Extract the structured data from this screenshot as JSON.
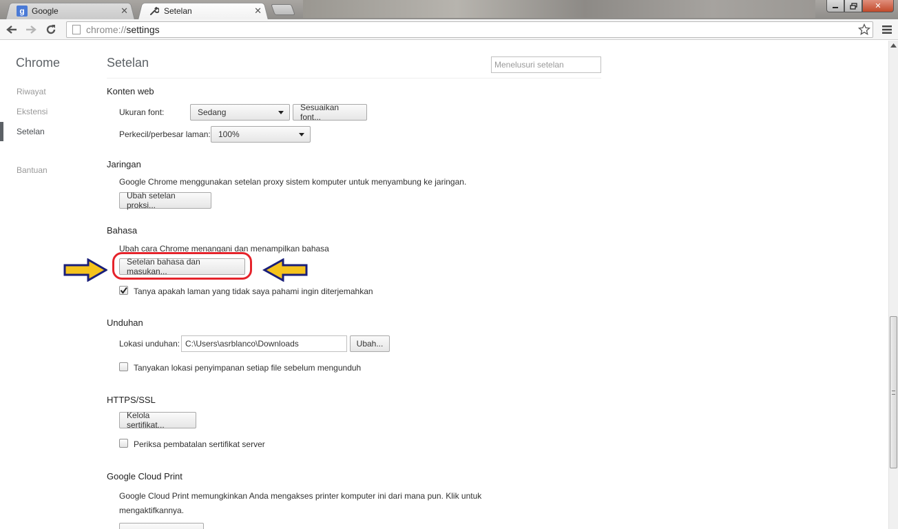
{
  "tabs": [
    {
      "title": "Google",
      "favicon": "google-g-icon",
      "favicon_glyph": "g"
    },
    {
      "title": "Setelan",
      "favicon": "wrench-icon"
    }
  ],
  "window": {
    "close_glyph": "✕"
  },
  "toolbar": {
    "url_scheme": "chrome://",
    "url_host": "settings"
  },
  "sidebar": {
    "brand": "Chrome",
    "items": [
      {
        "label": "Riwayat",
        "selected": false
      },
      {
        "label": "Ekstensi",
        "selected": false
      },
      {
        "label": "Setelan",
        "selected": true
      },
      {
        "label": "Bantuan",
        "selected": false
      }
    ]
  },
  "header": {
    "title": "Setelan",
    "search_placeholder": "Menelusuri setelan"
  },
  "web_content": {
    "title": "Konten web",
    "font_size_label": "Ukuran font:",
    "font_size_value": "Sedang",
    "customize_fonts_button": "Sesuaikan font...",
    "zoom_label": "Perkecil/perbesar laman:",
    "zoom_value": "100%"
  },
  "network": {
    "title": "Jaringan",
    "description": "Google Chrome menggunakan setelan proxy sistem komputer untuk menyambung ke jaringan.",
    "proxy_button": "Ubah setelan proksi..."
  },
  "languages": {
    "title": "Bahasa",
    "description": "Ubah cara Chrome menangani dan menampilkan bahasa",
    "language_button": "Setelan bahasa dan masukan...",
    "translate_checkbox": "Tanya apakah laman yang tidak saya pahami ingin diterjemahkan",
    "translate_checked": true
  },
  "downloads": {
    "title": "Unduhan",
    "location_label": "Lokasi unduhan:",
    "location_value": "C:\\Users\\asrblanco\\Downloads",
    "change_button": "Ubah...",
    "ask_checkbox": "Tanyakan lokasi penyimpanan setiap file sebelum mengunduh",
    "ask_checked": false
  },
  "https": {
    "title": "HTTPS/SSL",
    "certificates_button": "Kelola sertifikat...",
    "revocation_checkbox": "Periksa pembatalan sertifikat server",
    "revocation_checked": false
  },
  "cloud_print": {
    "title": "Google Cloud Print",
    "description_line1": "Google Cloud Print memungkinkan Anda mengakses printer komputer ini dari mana pun. Klik untuk",
    "description_line2": "mengaktifkannya."
  },
  "colors": {
    "highlight": "#e5232b",
    "arrow_fill": "#f5c31c",
    "arrow_stroke": "#1a1f7a"
  }
}
